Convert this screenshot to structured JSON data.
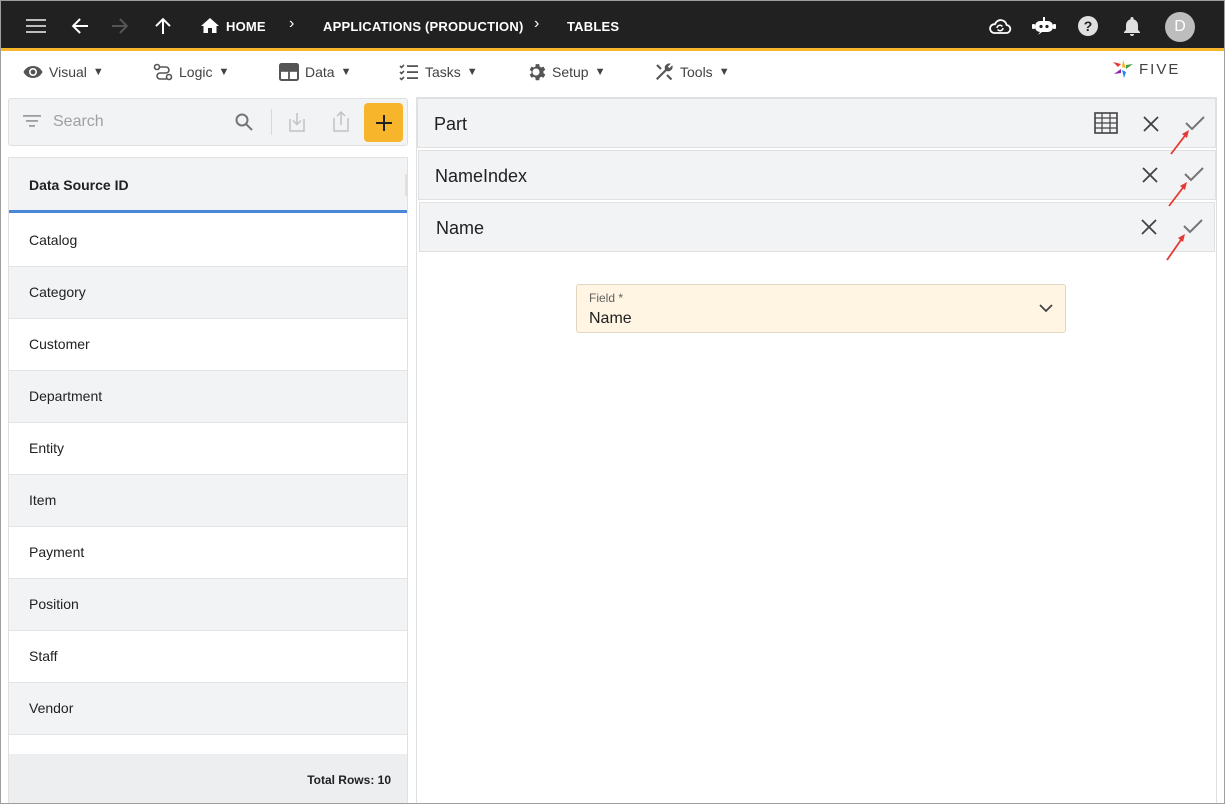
{
  "topbar": {
    "breadcrumbs": [
      "HOME",
      "APPLICATIONS (PRODUCTION)",
      "TABLES"
    ],
    "avatar_initial": "D",
    "icons": [
      "menu-icon",
      "back-arrow-icon",
      "forward-arrow-icon",
      "up-arrow-icon",
      "home-icon",
      "cloud-sync-icon",
      "chat-bot-icon",
      "help-icon",
      "notifications-icon"
    ]
  },
  "menu": {
    "items": [
      {
        "label": "Visual",
        "icon": "eye-icon"
      },
      {
        "label": "Logic",
        "icon": "logic-icon"
      },
      {
        "label": "Data",
        "icon": "table-icon"
      },
      {
        "label": "Tasks",
        "icon": "checklist-icon"
      },
      {
        "label": "Setup",
        "icon": "gear-icon"
      },
      {
        "label": "Tools",
        "icon": "tools-icon"
      }
    ],
    "dropdown_glyph": "▼",
    "logo_text": "FIVE"
  },
  "search": {
    "placeholder": "Search"
  },
  "list": {
    "header": "Data Source ID",
    "rows": [
      "Catalog",
      "Category",
      "Customer",
      "Department",
      "Entity",
      "Item",
      "Payment",
      "Position",
      "Staff",
      "Vendor"
    ],
    "footer": "Total Rows: 10"
  },
  "panels": [
    {
      "title": "Part"
    },
    {
      "title": "NameIndex"
    },
    {
      "title": "Name"
    }
  ],
  "form": {
    "field_label": "Field *",
    "field_value": "Name"
  },
  "colors": {
    "topbar": "#212121",
    "accent": "#f7b52c",
    "header_underline": "#4a86d6",
    "field_bg": "#fff5e2",
    "annotation_arrow": "#e53935"
  }
}
